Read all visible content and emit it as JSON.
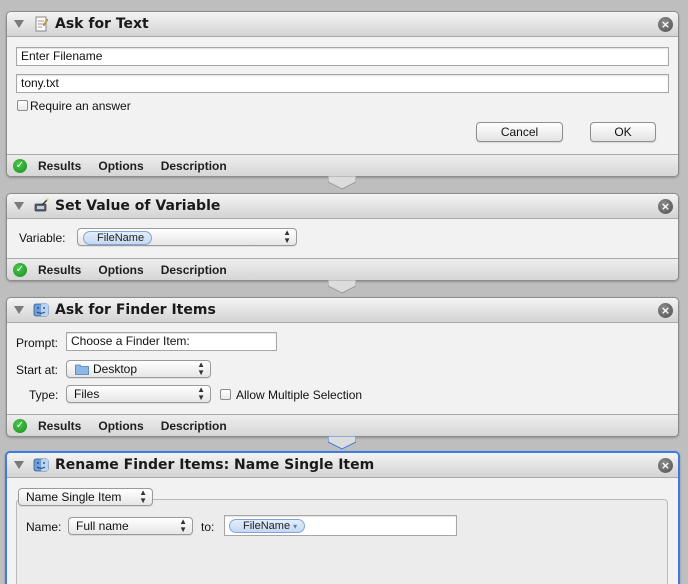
{
  "actions": [
    {
      "title": "Ask for Text",
      "icon": "text-document-icon",
      "fields": [
        {
          "value": "Enter Filename"
        },
        {
          "value": "tony.txt"
        }
      ],
      "require_answer_label": "Require an answer",
      "cancel_label": "Cancel",
      "ok_label": "OK",
      "footer": {
        "results": "Results",
        "options": "Options",
        "description": "Description"
      }
    },
    {
      "title": "Set Value of Variable",
      "icon": "variable-wand-icon",
      "variable_label": "Variable:",
      "variable_value": "FileName",
      "footer": {
        "results": "Results",
        "options": "Options",
        "description": "Description"
      }
    },
    {
      "title": "Ask for Finder Items",
      "icon": "finder-icon",
      "prompt_label": "Prompt:",
      "prompt_value": "Choose a Finder Item:",
      "start_at_label": "Start at:",
      "start_at_value": "Desktop",
      "type_label": "Type:",
      "type_value": "Files",
      "allow_multiple_label": "Allow Multiple Selection",
      "footer": {
        "results": "Results",
        "options": "Options",
        "description": "Description"
      }
    },
    {
      "title": "Rename Finder Items: Name Single Item",
      "icon": "finder-icon",
      "mode_value": "Name Single Item",
      "name_label": "Name:",
      "name_value": "Full name",
      "to_label": "to:",
      "to_token": "FileName"
    }
  ],
  "colors": {
    "selection_border": "#3d7be0",
    "success_check": "#1c8d22"
  }
}
